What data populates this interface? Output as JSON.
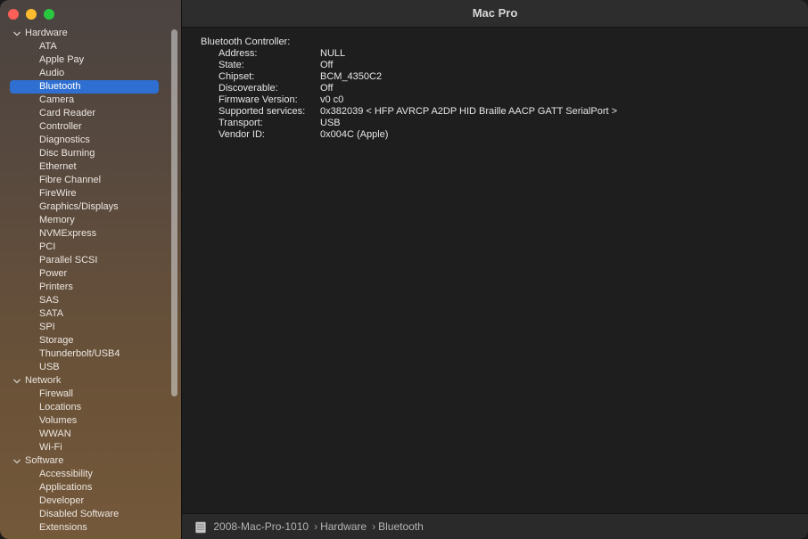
{
  "window": {
    "title": "Mac Pro"
  },
  "sidebar": {
    "groups": [
      {
        "label": "Hardware",
        "items": [
          "ATA",
          "Apple Pay",
          "Audio",
          "Bluetooth",
          "Camera",
          "Card Reader",
          "Controller",
          "Diagnostics",
          "Disc Burning",
          "Ethernet",
          "Fibre Channel",
          "FireWire",
          "Graphics/Displays",
          "Memory",
          "NVMExpress",
          "PCI",
          "Parallel SCSI",
          "Power",
          "Printers",
          "SAS",
          "SATA",
          "SPI",
          "Storage",
          "Thunderbolt/USB4",
          "USB"
        ]
      },
      {
        "label": "Network",
        "items": [
          "Firewall",
          "Locations",
          "Volumes",
          "WWAN",
          "Wi-Fi"
        ]
      },
      {
        "label": "Software",
        "items": [
          "Accessibility",
          "Applications",
          "Developer",
          "Disabled Software",
          "Extensions"
        ]
      }
    ],
    "selected": "Bluetooth"
  },
  "detail": {
    "section_title": "Bluetooth Controller:",
    "rows": [
      {
        "key": "Address:",
        "value": "NULL"
      },
      {
        "key": "State:",
        "value": "Off"
      },
      {
        "key": "Chipset:",
        "value": "BCM_4350C2"
      },
      {
        "key": "Discoverable:",
        "value": "Off"
      },
      {
        "key": "Firmware Version:",
        "value": "v0 c0"
      },
      {
        "key": "Supported services:",
        "value": "0x382039 < HFP AVRCP A2DP HID Braille AACP GATT SerialPort >"
      },
      {
        "key": "Transport:",
        "value": "USB"
      },
      {
        "key": "Vendor ID:",
        "value": "0x004C (Apple)"
      }
    ]
  },
  "pathbar": {
    "icon": "mac-pro-icon",
    "segments": [
      "2008-Mac-Pro-1010",
      "Hardware",
      "Bluetooth"
    ],
    "separator": "›"
  },
  "colors": {
    "selection": "#2f6fd1",
    "close": "#fe5f57",
    "minimize": "#febc2e",
    "maximize": "#28c840"
  }
}
